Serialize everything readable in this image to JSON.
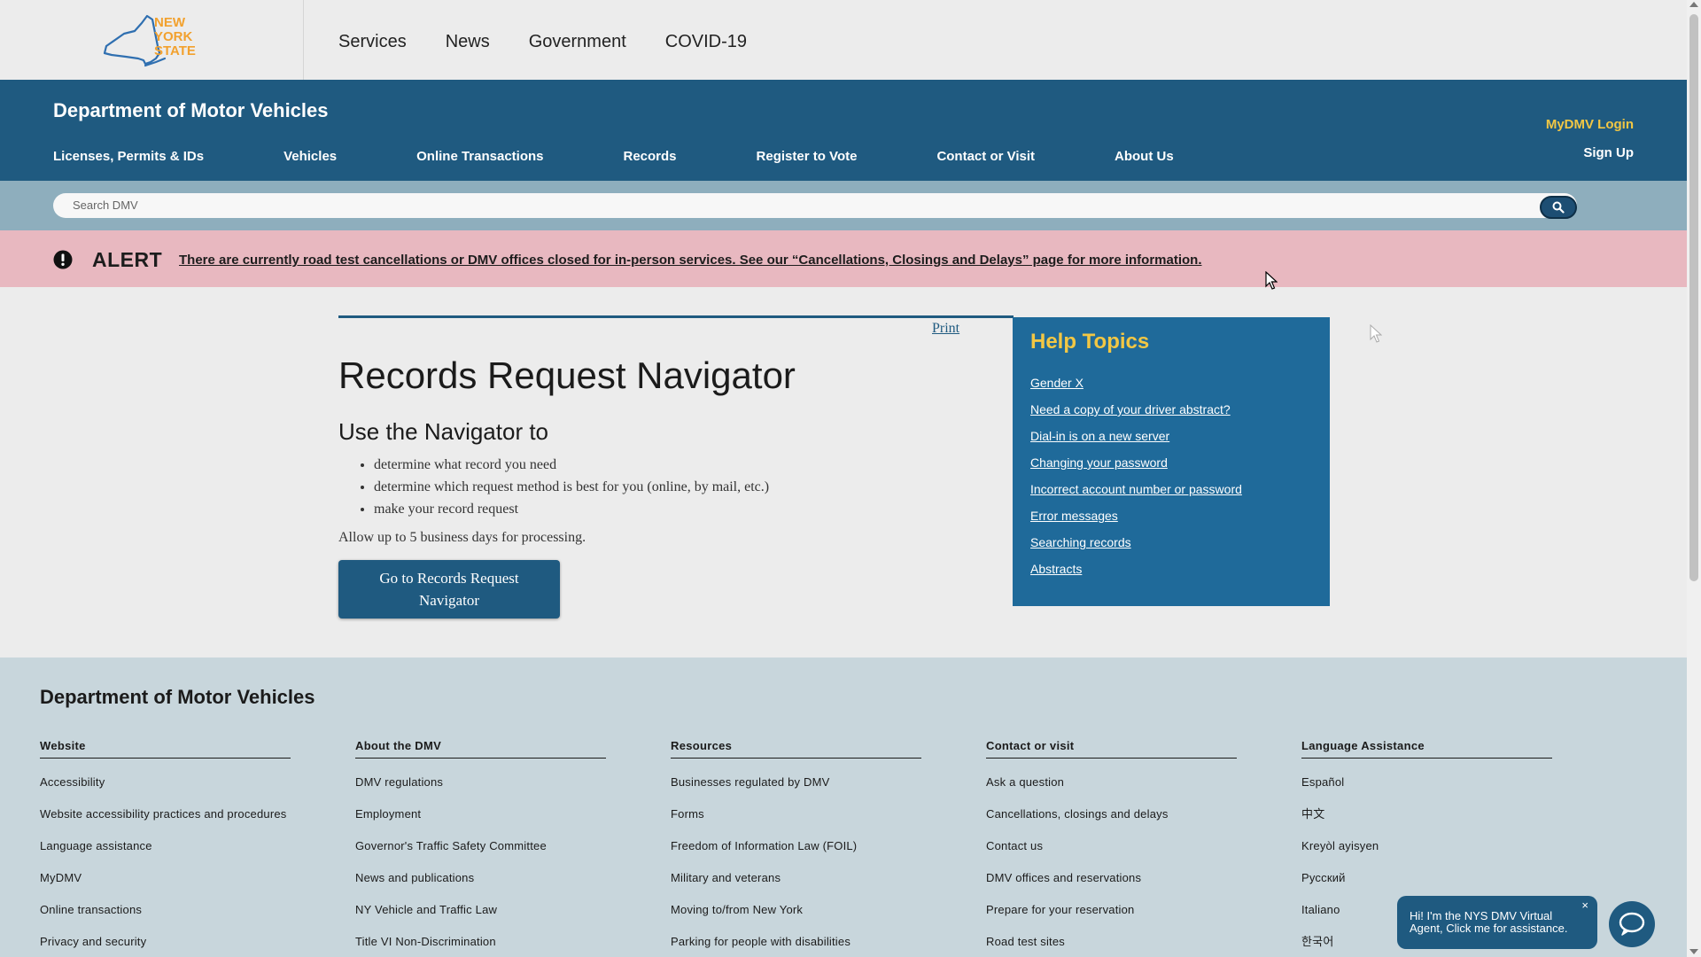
{
  "colors": {
    "primary": "#1f5a80",
    "accent_yellow": "#f2c744",
    "alert_bg": "#e8b8c0",
    "footer_bg": "#c8d6dc"
  },
  "state_header": {
    "logo_text": [
      "NEW",
      "YORK",
      "STATE"
    ],
    "nav": [
      "Services",
      "News",
      "Government",
      "COVID-19"
    ]
  },
  "dmv_header": {
    "title": "Department of Motor Vehicles",
    "nav": [
      "Licenses, Permits & IDs",
      "Vehicles",
      "Online Transactions",
      "Records",
      "Register to Vote",
      "Contact or Visit",
      "About Us"
    ],
    "mydmv_login": "MyDMV Login",
    "sign_up": "Sign Up"
  },
  "search": {
    "placeholder": "Search DMV",
    "button_icon": "search-icon"
  },
  "alert": {
    "icon": "exclamation-circle-icon",
    "label": "ALERT",
    "message": "There are currently road test cancellations or DMV offices closed for in-person services. See our “Cancellations, Closings and Delays” page for more information."
  },
  "main": {
    "print": "Print",
    "title": "Records Request Navigator",
    "subtitle": "Use the Navigator to",
    "bullets": [
      "determine what record you need",
      "determine which request method is best for you (online, by mail, etc.)",
      "make your record request"
    ],
    "note": "Allow up to 5 business days for processing.",
    "button": "Go to Records Request Navigator"
  },
  "help_topics": {
    "title": "Help Topics",
    "links": [
      "Gender X",
      "Need a copy of your driver abstract?",
      "Dial-in is on a new server",
      "Changing your password",
      "Incorrect account number or password",
      "Error messages",
      "Searching records",
      "Abstracts"
    ]
  },
  "footer": {
    "title": "Department of Motor Vehicles",
    "columns": [
      {
        "heading": "Website",
        "links": [
          "Accessibility",
          "Website accessibility practices and procedures",
          "Language assistance",
          "MyDMV",
          "Online transactions",
          "Privacy and security"
        ]
      },
      {
        "heading": "About the DMV",
        "links": [
          "DMV regulations",
          "Employment",
          "Governor's Traffic Safety Committee",
          "News and publications",
          "NY Vehicle and Traffic Law",
          "Title VI Non-Discrimination"
        ]
      },
      {
        "heading": "Resources",
        "links": [
          "Businesses regulated by DMV",
          "Forms",
          "Freedom of Information Law (FOIL)",
          "Military and veterans",
          "Moving to/from New York",
          "Parking for people with disabilities"
        ]
      },
      {
        "heading": "Contact or visit",
        "links": [
          "Ask a question",
          "Cancellations, closings and delays",
          "Contact us",
          "DMV offices and reservations",
          "Prepare for your reservation",
          "Road test sites"
        ]
      },
      {
        "heading": "Language Assistance",
        "links": [
          "Español",
          "中文",
          "Kreyòl ayisyen",
          "Русский",
          "Italiano",
          "한국어"
        ]
      }
    ]
  },
  "chat": {
    "message": "Hi! I'm the NYS DMV Virtual Agent, Click me for assistance.",
    "close": "×",
    "icon": "chat-icon"
  }
}
